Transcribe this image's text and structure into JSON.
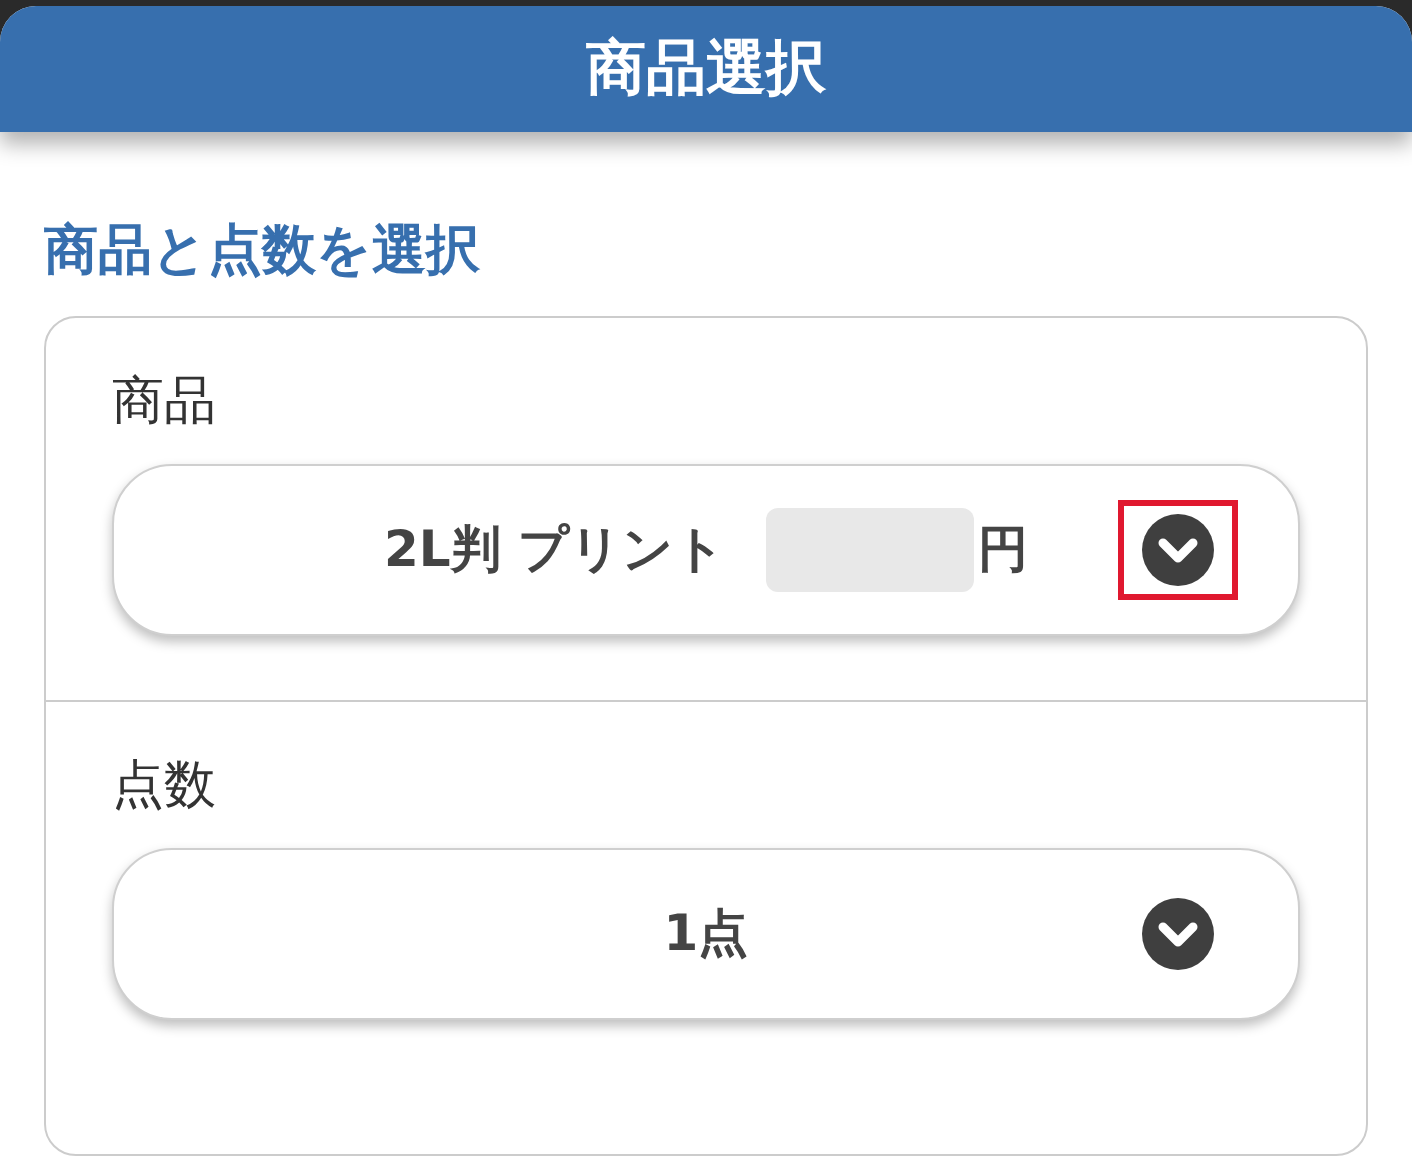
{
  "header": {
    "title": "商品選択"
  },
  "section_title": "商品と点数を選択",
  "fields": [
    {
      "label": "商品",
      "value": "2L判 プリント",
      "redacted": true,
      "suffix": "円",
      "highlighted": true
    },
    {
      "label": "点数",
      "value": "1点",
      "redacted": false,
      "highlighted": false
    }
  ]
}
